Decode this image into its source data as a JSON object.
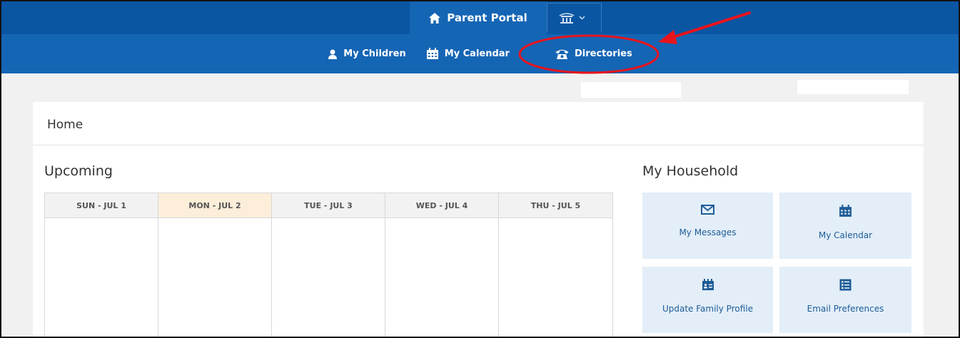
{
  "header": {
    "portal_title": "Parent Portal"
  },
  "nav": {
    "items": [
      {
        "label": "My Children",
        "icon": "person-icon"
      },
      {
        "label": "My Calendar",
        "icon": "calendar-icon"
      },
      {
        "label": "Directories",
        "icon": "telephone-icon"
      }
    ]
  },
  "page": {
    "title": "Home"
  },
  "upcoming": {
    "heading": "Upcoming",
    "days": [
      "SUN - JUL 1",
      "MON - JUL 2",
      "TUE - JUL 3",
      "WED - JUL 4",
      "THU - JUL 5"
    ]
  },
  "household": {
    "heading": "My Household",
    "tiles": [
      {
        "label": "My Messages",
        "icon": "envelope-icon"
      },
      {
        "label": "My Calendar",
        "icon": "calendar-icon"
      },
      {
        "label": "Update Family Profile",
        "icon": "family-card-icon"
      },
      {
        "label": "Email Preferences",
        "icon": "preferences-list-icon"
      }
    ]
  },
  "colors": {
    "topbar": "#0a56a3",
    "nav": "#1565b5",
    "tile_bg": "#e3eef8",
    "today_header": "#fdeeda",
    "annotation": "#e8141c"
  }
}
